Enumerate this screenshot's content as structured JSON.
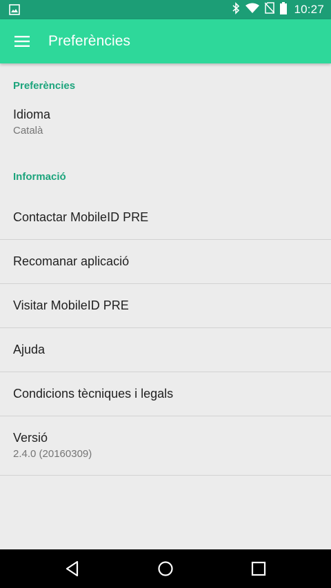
{
  "status_bar": {
    "time": "10:27",
    "icons": [
      "image-icon",
      "bluetooth-icon",
      "wifi-icon",
      "no-sim-icon",
      "battery-icon"
    ]
  },
  "app_bar": {
    "title": "Preferències",
    "menu_icon": "hamburger-menu-icon"
  },
  "sections": {
    "preferences": {
      "header": "Preferències",
      "language": {
        "title": "Idioma",
        "value": "Català"
      }
    },
    "information": {
      "header": "Informació",
      "items": [
        {
          "title": "Contactar MobileID PRE"
        },
        {
          "title": "Recomanar aplicació"
        },
        {
          "title": "Visitar MobileID PRE"
        },
        {
          "title": "Ajuda"
        },
        {
          "title": "Condicions tècniques i legals"
        }
      ],
      "version": {
        "title": "Versió",
        "value": "2.4.0 (20160309)"
      }
    }
  },
  "nav_bar": {
    "icons": [
      "back-icon",
      "home-icon",
      "recents-icon"
    ]
  },
  "colors": {
    "status_bar": "#1c9e76",
    "app_bar": "#2ed89a",
    "accent": "#1ca47c",
    "background": "#ececec"
  }
}
